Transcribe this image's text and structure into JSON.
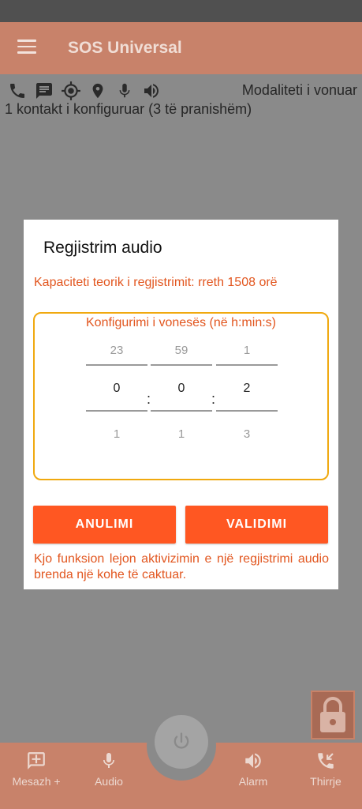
{
  "app": {
    "title": "SOS Universal"
  },
  "status": {
    "mode": "Modaliteti i vonuar",
    "contacts": "1 kontakt i konfiguruar (3 të pranishëm)"
  },
  "dialog": {
    "title": "Regjistrim audio",
    "capacity": "Kapaciteti teorik i regjistrimit: rreth 1508 orë",
    "delay_label": "Konfigurimi i vonesës (në h:min:s)",
    "picker": {
      "hours": {
        "prev": "23",
        "value": "0",
        "next": "1"
      },
      "minutes": {
        "prev": "59",
        "value": "0",
        "next": "1"
      },
      "seconds": {
        "prev": "1",
        "value": "2",
        "next": "3"
      }
    },
    "separator": ":",
    "cancel_label": "ANULIMI",
    "ok_label": "VALIDIMI",
    "info": "Kjo funksion lejon aktivizimin e një regjistrimi audio brenda një kohe të caktuar."
  },
  "bottom_nav": {
    "message": "Mesazh +",
    "audio": "Audio",
    "alarm": "Alarm",
    "call": "Thirrje"
  },
  "colors": {
    "accent": "#ff5722",
    "accent_text": "#e2561f",
    "picker_border": "#f0a90f",
    "appbar_dimmed": "#c8826a"
  },
  "icons": [
    "menu-icon",
    "phone-icon",
    "message-icon",
    "gps-icon",
    "location-pin-icon",
    "microphone-icon",
    "volume-icon",
    "lock-icon",
    "power-icon",
    "add-message-icon",
    "call-received-icon"
  ]
}
